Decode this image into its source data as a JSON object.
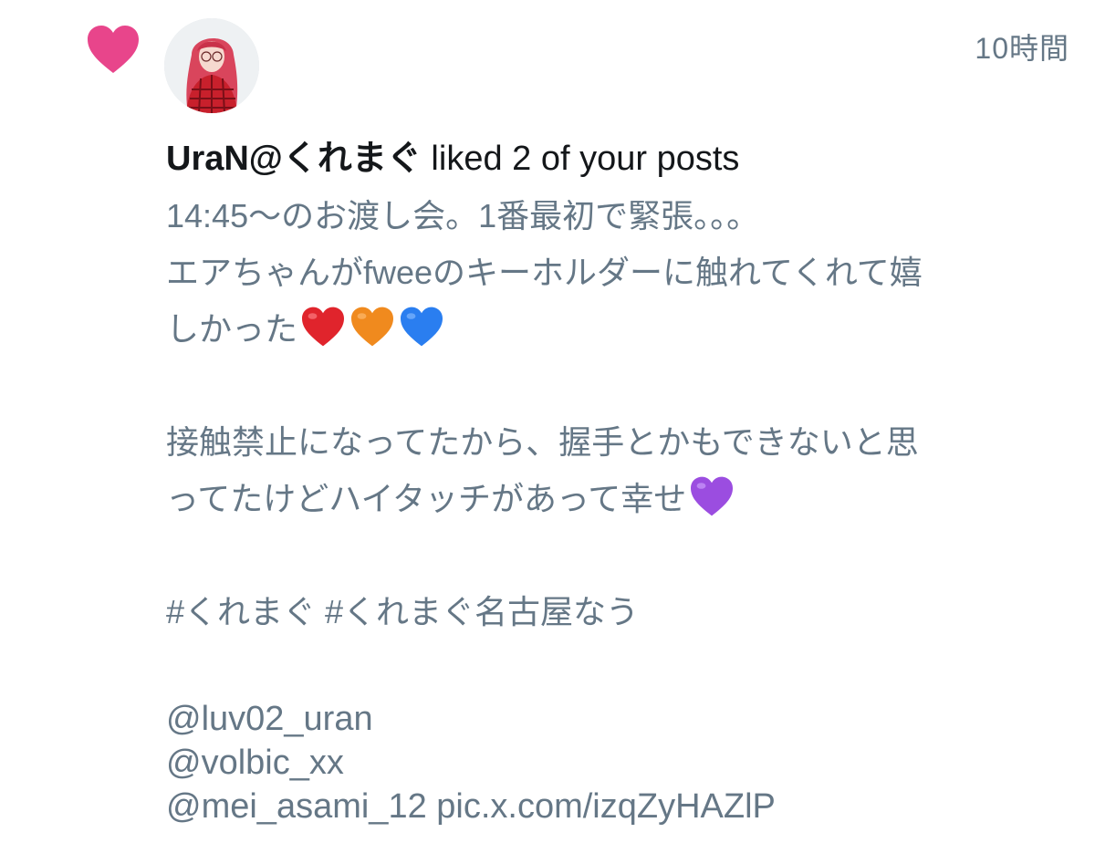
{
  "notification": {
    "timestamp": "10時間",
    "user_name": "UraN@くれまぐ",
    "action_text": " liked 2 of your posts",
    "icons": {
      "like": "heart-icon",
      "like_color": "#e8458b"
    },
    "post": {
      "line1": "14:45〜のお渡し会。1番最初で緊張。。。",
      "line2": "エアちゃんがfweeのキーホルダーに触れてくれて嬉",
      "line3": "しかった",
      "line4": "接触禁止になってたから、握手とかもできないと思",
      "line5": "ってたけどハイタッチがあって幸せ",
      "hashtags": "#くれまぐ #くれまぐ名古屋なう",
      "mention1": "@luv02_uran",
      "mention2": "@volbic_xx",
      "mention3": "@mei_asami_12 pic.x.com/izqZyHAZlP"
    },
    "emoji": {
      "red_heart": "#e0242c",
      "orange_heart": "#f08a1e",
      "blue_heart": "#2a7ef0",
      "purple_heart": "#9b4de0"
    }
  }
}
